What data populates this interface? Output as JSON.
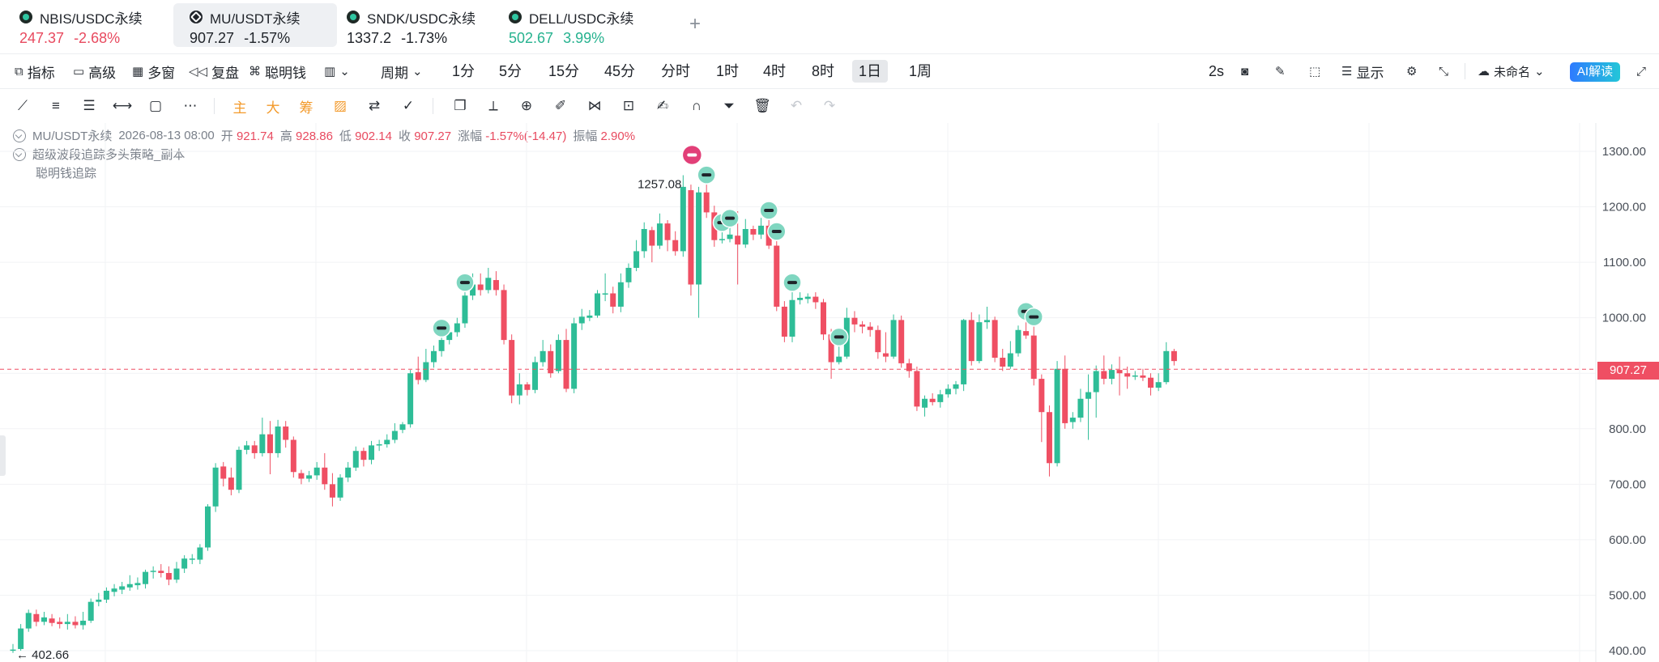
{
  "tabs": [
    {
      "symbol": "NBIS/USDC永续",
      "price": "247.37",
      "change": "-2.68%",
      "price_tone": "neg",
      "change_tone": "neg",
      "active": false
    },
    {
      "symbol": "MU/USDT永续",
      "price": "907.27",
      "change": "-1.57%",
      "price_tone": "dark",
      "change_tone": "dark",
      "active": true
    },
    {
      "symbol": "SNDK/USDC永续",
      "price": "1337.2",
      "change": "-1.73%",
      "price_tone": "dark",
      "change_tone": "dark",
      "active": false
    },
    {
      "symbol": "DELL/USDC永续",
      "price": "502.67",
      "change": "3.99%",
      "price_tone": "pos",
      "change_tone": "pos",
      "active": false
    }
  ],
  "tab_add_label": "+",
  "toolbar": {
    "indicator": "指标",
    "advanced": "高级",
    "multi_window": "多窗",
    "replay": "复盘",
    "smart_money": "聪明钱",
    "period": "周期",
    "periods": [
      "1分",
      "5分",
      "15分",
      "45分",
      "分时",
      "1时",
      "4时",
      "8时",
      "1日",
      "1周"
    ],
    "active_period": "1日",
    "refresh": "2s",
    "display": "显示",
    "unnamed": "未命名",
    "ai": "AI解读"
  },
  "drawing_tools": {
    "main": "主",
    "big": "大",
    "chip": "筹"
  },
  "legend": {
    "symbol": "MU/USDT永续",
    "date": "2026-08-13 08:00",
    "open_label": "开",
    "open": "921.74",
    "high_label": "高",
    "high": "928.86",
    "low_label": "低",
    "low": "902.14",
    "close_label": "收",
    "close": "907.27",
    "change_label": "涨幅",
    "change": "-1.57%(-14.47)",
    "amplitude_label": "振幅",
    "amplitude": "2.90%",
    "strategy": "超级波段追踪多头策略_副本",
    "indicator": "聪明钱追踪"
  },
  "chart_data": {
    "type": "candlestick",
    "y_ticks": [
      "1300.00",
      "1200.00",
      "1100.00",
      "1000.00",
      "900.00",
      "800.00",
      "700.00",
      "600.00",
      "500.00",
      "400.00"
    ],
    "ylim": [
      385,
      1310
    ],
    "last_price": "907.27",
    "high_marker": "1257.08",
    "low_marker": "← 402.66",
    "colors": {
      "up": "#2ebd97",
      "down": "#ef4f63",
      "grid": "#f2f3f5"
    },
    "candles": [
      [
        400,
        402,
        412,
        396
      ],
      [
        403,
        440,
        448,
        400
      ],
      [
        440,
        468,
        474,
        434
      ],
      [
        466,
        452,
        474,
        444
      ],
      [
        452,
        460,
        470,
        446
      ],
      [
        458,
        450,
        466,
        444
      ],
      [
        452,
        448,
        460,
        440
      ],
      [
        448,
        452,
        466,
        438
      ],
      [
        452,
        446,
        462,
        440
      ],
      [
        446,
        454,
        470,
        438
      ],
      [
        454,
        488,
        494,
        450
      ],
      [
        488,
        492,
        504,
        480
      ],
      [
        492,
        508,
        514,
        486
      ],
      [
        506,
        512,
        520,
        498
      ],
      [
        510,
        516,
        524,
        502
      ],
      [
        514,
        520,
        536,
        508
      ],
      [
        518,
        522,
        532,
        510
      ],
      [
        520,
        542,
        546,
        512
      ],
      [
        542,
        544,
        552,
        530
      ],
      [
        544,
        540,
        556,
        532
      ],
      [
        540,
        528,
        552,
        518
      ],
      [
        528,
        548,
        560,
        522
      ],
      [
        548,
        566,
        572,
        540
      ],
      [
        566,
        566,
        574,
        556
      ],
      [
        564,
        586,
        592,
        556
      ],
      [
        586,
        660,
        664,
        580
      ],
      [
        660,
        730,
        738,
        650
      ],
      [
        732,
        710,
        740,
        696
      ],
      [
        712,
        690,
        730,
        680
      ],
      [
        690,
        762,
        768,
        684
      ],
      [
        762,
        770,
        778,
        754
      ],
      [
        770,
        756,
        778,
        746
      ],
      [
        756,
        790,
        820,
        750
      ],
      [
        790,
        756,
        814,
        718
      ],
      [
        756,
        804,
        816,
        748
      ],
      [
        804,
        780,
        814,
        766
      ],
      [
        780,
        722,
        786,
        712
      ],
      [
        720,
        710,
        726,
        700
      ],
      [
        710,
        716,
        724,
        704
      ],
      [
        716,
        730,
        740,
        708
      ],
      [
        730,
        700,
        756,
        690
      ],
      [
        700,
        676,
        720,
        660
      ],
      [
        676,
        712,
        718,
        670
      ],
      [
        712,
        730,
        740,
        704
      ],
      [
        730,
        760,
        768,
        724
      ],
      [
        760,
        744,
        766,
        732
      ],
      [
        744,
        770,
        778,
        736
      ],
      [
        770,
        772,
        780,
        760
      ],
      [
        772,
        780,
        790,
        766
      ],
      [
        780,
        796,
        810,
        774
      ],
      [
        798,
        808,
        812,
        792
      ],
      [
        808,
        900,
        906,
        802
      ],
      [
        902,
        888,
        930,
        880
      ],
      [
        888,
        920,
        944,
        884
      ],
      [
        920,
        940,
        950,
        910
      ],
      [
        940,
        960,
        964,
        930
      ],
      [
        960,
        974,
        984,
        952
      ],
      [
        974,
        990,
        1000,
        966
      ],
      [
        990,
        1040,
        1046,
        982
      ],
      [
        1040,
        1060,
        1080,
        1032
      ],
      [
        1060,
        1050,
        1080,
        1040
      ],
      [
        1050,
        1072,
        1090,
        1044
      ],
      [
        1068,
        1050,
        1084,
        1040
      ],
      [
        1050,
        960,
        1060,
        952
      ],
      [
        960,
        860,
        970,
        846
      ],
      [
        860,
        880,
        900,
        844
      ],
      [
        880,
        870,
        884,
        860
      ],
      [
        870,
        920,
        930,
        864
      ],
      [
        920,
        940,
        960,
        912
      ],
      [
        940,
        900,
        952,
        892
      ],
      [
        904,
        960,
        970,
        900
      ],
      [
        960,
        872,
        980,
        866
      ],
      [
        872,
        990,
        1000,
        864
      ],
      [
        990,
        1002,
        1016,
        978
      ],
      [
        1000,
        1004,
        1014,
        994
      ],
      [
        1004,
        1044,
        1050,
        1000
      ],
      [
        1044,
        1044,
        1080,
        1030
      ],
      [
        1044,
        1020,
        1056,
        1008
      ],
      [
        1020,
        1064,
        1080,
        1010
      ],
      [
        1064,
        1090,
        1098,
        1054
      ],
      [
        1090,
        1120,
        1140,
        1084
      ],
      [
        1120,
        1160,
        1172,
        1108
      ],
      [
        1158,
        1130,
        1164,
        1100
      ],
      [
        1130,
        1170,
        1188,
        1124
      ],
      [
        1170,
        1140,
        1176,
        1120
      ],
      [
        1140,
        1120,
        1156,
        1112
      ],
      [
        1120,
        1236,
        1257,
        1110
      ],
      [
        1230,
        1060,
        1240,
        1040
      ],
      [
        1060,
        1226,
        1236,
        1000
      ],
      [
        1226,
        1190,
        1240,
        1180
      ],
      [
        1190,
        1140,
        1202,
        1128
      ],
      [
        1140,
        1142,
        1154,
        1134
      ],
      [
        1142,
        1150,
        1162,
        1136
      ],
      [
        1148,
        1132,
        1192,
        1060
      ],
      [
        1132,
        1160,
        1178,
        1126
      ],
      [
        1160,
        1150,
        1166,
        1140
      ],
      [
        1150,
        1166,
        1180,
        1142
      ],
      [
        1166,
        1130,
        1176,
        1124
      ],
      [
        1130,
        1020,
        1138,
        1012
      ],
      [
        1020,
        966,
        1030,
        956
      ],
      [
        966,
        1032,
        1046,
        956
      ],
      [
        1032,
        1036,
        1046,
        1024
      ],
      [
        1034,
        1038,
        1044,
        1026
      ],
      [
        1038,
        1028,
        1046,
        1016
      ],
      [
        1028,
        970,
        1034,
        960
      ],
      [
        970,
        920,
        980,
        890
      ],
      [
        920,
        930,
        948,
        916
      ],
      [
        930,
        1000,
        1018,
        926
      ],
      [
        1000,
        988,
        1012,
        974
      ],
      [
        988,
        984,
        994,
        972
      ],
      [
        984,
        978,
        992,
        966
      ],
      [
        978,
        938,
        986,
        926
      ],
      [
        936,
        930,
        974,
        920
      ],
      [
        930,
        996,
        1006,
        926
      ],
      [
        996,
        918,
        1004,
        910
      ],
      [
        918,
        904,
        926,
        892
      ],
      [
        904,
        840,
        912,
        832
      ],
      [
        838,
        854,
        860,
        822
      ],
      [
        854,
        848,
        864,
        842
      ],
      [
        848,
        862,
        870,
        838
      ],
      [
        862,
        872,
        880,
        856
      ],
      [
        872,
        880,
        886,
        862
      ],
      [
        880,
        996,
        998,
        868
      ],
      [
        996,
        922,
        1010,
        914
      ],
      [
        922,
        992,
        1006,
        918
      ],
      [
        992,
        996,
        1020,
        980
      ],
      [
        996,
        928,
        1002,
        920
      ],
      [
        928,
        912,
        944,
        904
      ],
      [
        912,
        936,
        958,
        908
      ],
      [
        936,
        978,
        986,
        930
      ],
      [
        976,
        968,
        994,
        962
      ],
      [
        968,
        890,
        984,
        878
      ],
      [
        890,
        830,
        898,
        776
      ],
      [
        830,
        738,
        842,
        714
      ],
      [
        738,
        908,
        922,
        732
      ],
      [
        908,
        810,
        932,
        800
      ],
      [
        812,
        820,
        830,
        800
      ],
      [
        820,
        854,
        872,
        812
      ],
      [
        854,
        866,
        898,
        780
      ],
      [
        866,
        904,
        914,
        820
      ],
      [
        904,
        890,
        932,
        880
      ],
      [
        890,
        906,
        916,
        880
      ],
      [
        906,
        900,
        930,
        860
      ],
      [
        900,
        894,
        912,
        872
      ],
      [
        894,
        896,
        904,
        888
      ],
      [
        896,
        892,
        908,
        886
      ],
      [
        892,
        874,
        900,
        860
      ],
      [
        874,
        884,
        900,
        868
      ],
      [
        884,
        940,
        956,
        880
      ],
      [
        940,
        922,
        944,
        914
      ]
    ]
  }
}
